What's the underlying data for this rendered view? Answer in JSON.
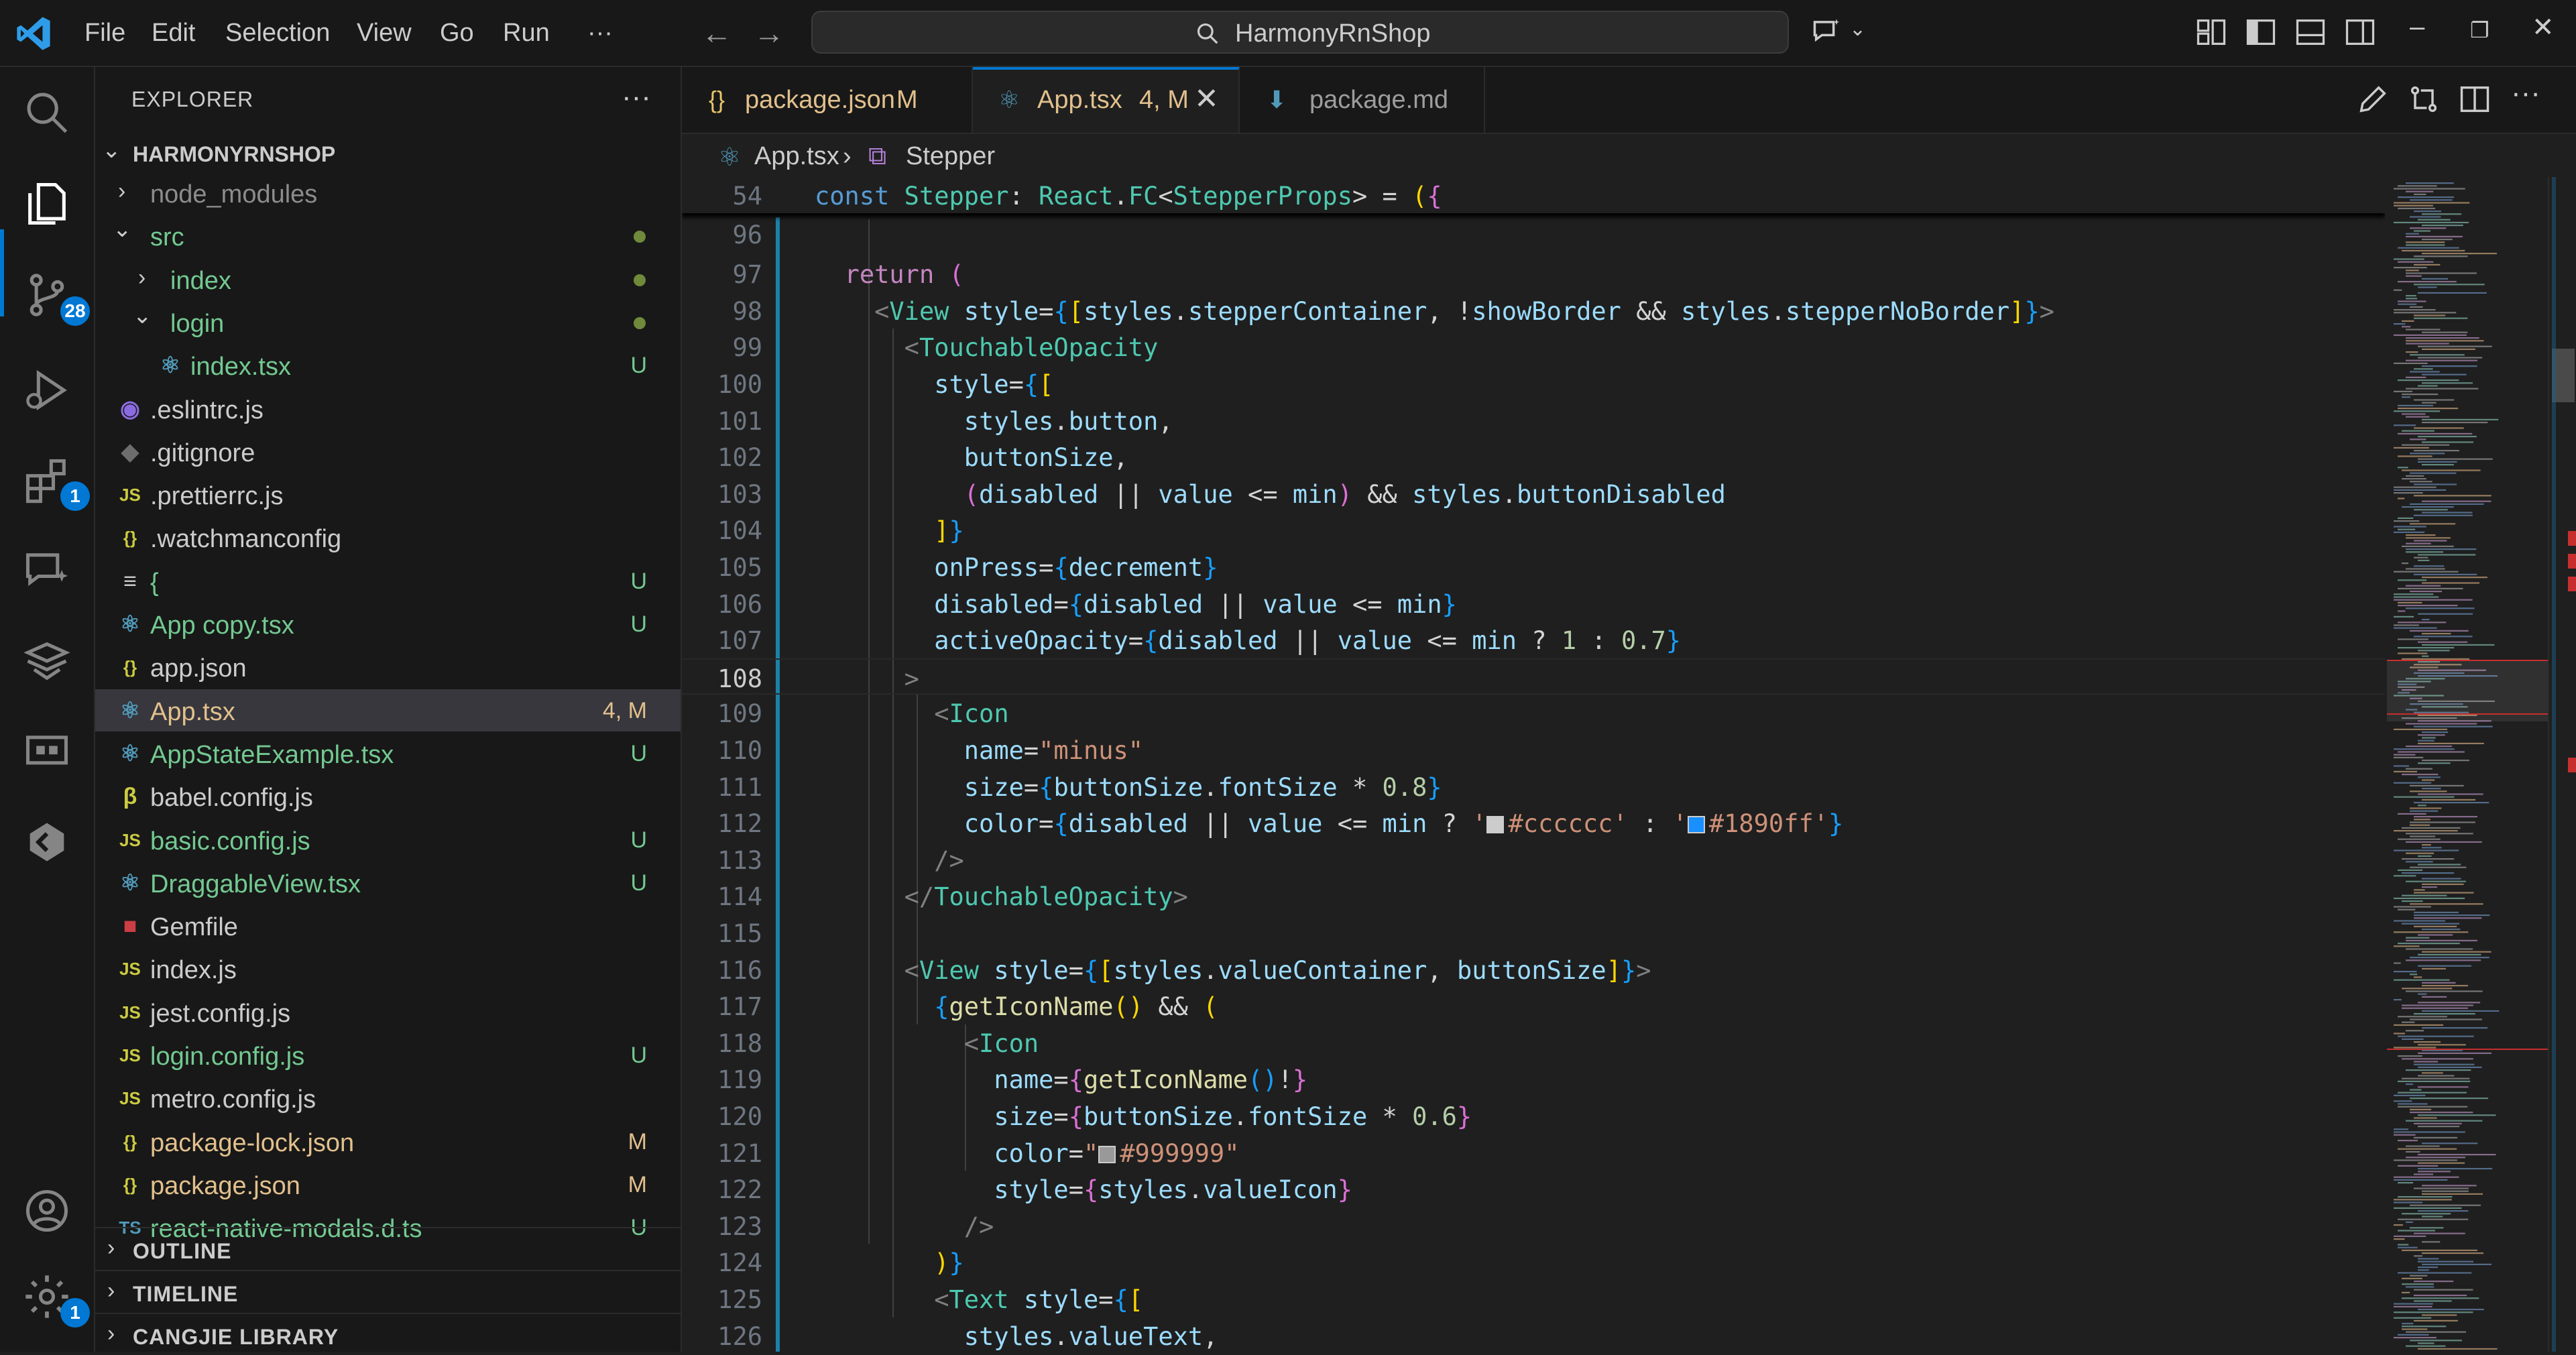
{
  "titlebar": {
    "menus": [
      "File",
      "Edit",
      "Selection",
      "View",
      "Go",
      "Run",
      "···"
    ],
    "search_text": "HarmonyRnShop"
  },
  "activity": {
    "source_control_badge": "28",
    "extensions_badge": "1",
    "settings_badge": "1"
  },
  "explorer": {
    "title": "EXPLORER",
    "more": "···",
    "root": "HARMONYRNSHOP",
    "items": [
      {
        "label": "node_modules",
        "type": "folder-collapsed",
        "indent": 1,
        "color": "#8c8c8c"
      },
      {
        "label": "src",
        "type": "folder-open",
        "indent": 1,
        "color": "#73c991",
        "dot": true
      },
      {
        "label": "index",
        "type": "folder-collapsed",
        "indent": 2,
        "color": "#73c991",
        "dot": true
      },
      {
        "label": "login",
        "type": "folder-open",
        "indent": 2,
        "color": "#73c991",
        "dot": true
      },
      {
        "label": "index.tsx",
        "type": "react",
        "indent": 3,
        "color": "#73c991",
        "status": "U"
      },
      {
        "label": ".eslintrc.js",
        "type": "eslint",
        "indent": 1,
        "color": "#cccccc"
      },
      {
        "label": ".gitignore",
        "type": "git",
        "indent": 1,
        "color": "#cccccc"
      },
      {
        "label": ".prettierrc.js",
        "type": "js",
        "indent": 1,
        "color": "#cccccc"
      },
      {
        "label": ".watchmanconfig",
        "type": "json",
        "indent": 1,
        "color": "#cccccc"
      },
      {
        "label": "{",
        "type": "text",
        "indent": 1,
        "color": "#73c991",
        "status": "U"
      },
      {
        "label": "App copy.tsx",
        "type": "react",
        "indent": 1,
        "color": "#73c991",
        "status": "U"
      },
      {
        "label": "app.json",
        "type": "json",
        "indent": 1,
        "color": "#cccccc"
      },
      {
        "label": "App.tsx",
        "type": "react",
        "indent": 1,
        "color": "#e2c08d",
        "status": "4, M",
        "selected": true
      },
      {
        "label": "AppStateExample.tsx",
        "type": "react",
        "indent": 1,
        "color": "#73c991",
        "status": "U"
      },
      {
        "label": "babel.config.js",
        "type": "babel",
        "indent": 1,
        "color": "#cccccc"
      },
      {
        "label": "basic.config.js",
        "type": "js",
        "indent": 1,
        "color": "#73c991",
        "status": "U"
      },
      {
        "label": "DraggableView.tsx",
        "type": "react",
        "indent": 1,
        "color": "#73c991",
        "status": "U"
      },
      {
        "label": "Gemfile",
        "type": "ruby",
        "indent": 1,
        "color": "#cccccc"
      },
      {
        "label": "index.js",
        "type": "js",
        "indent": 1,
        "color": "#cccccc"
      },
      {
        "label": "jest.config.js",
        "type": "js",
        "indent": 1,
        "color": "#cccccc"
      },
      {
        "label": "login.config.js",
        "type": "js",
        "indent": 1,
        "color": "#73c991",
        "status": "U"
      },
      {
        "label": "metro.config.js",
        "type": "js",
        "indent": 1,
        "color": "#cccccc"
      },
      {
        "label": "package-lock.json",
        "type": "json",
        "indent": 1,
        "color": "#e2c08d",
        "status": "M"
      },
      {
        "label": "package.json",
        "type": "json",
        "indent": 1,
        "color": "#e2c08d",
        "status": "M"
      },
      {
        "label": "react-native-modals.d.ts",
        "type": "ts",
        "indent": 1,
        "color": "#73c991",
        "status": "U"
      }
    ],
    "sections": [
      "OUTLINE",
      "TIMELINE",
      "CANGJIE LIBRARY"
    ]
  },
  "tabs": [
    {
      "icon": "{}",
      "label": "package.json",
      "suffix": "M",
      "color": "#e2c08d",
      "active": false
    },
    {
      "icon": "⚛",
      "label": "App.tsx",
      "suffix": "4, M",
      "color": "#e2c08d",
      "active": true
    },
    {
      "icon": "⬇",
      "label": "package.md",
      "suffix": "",
      "color": "#9d9d9d",
      "active": false
    }
  ],
  "breadcrumb": {
    "file": "App.tsx",
    "symbol": "Stepper"
  },
  "editor": {
    "current_line": "108",
    "lines": [
      {
        "n": "54",
        "sticky": true,
        "code": [
          [
            "k",
            "const "
          ],
          [
            "c",
            "Stepper"
          ],
          [
            "p",
            ": "
          ],
          [
            "c",
            "React"
          ],
          [
            "p",
            "."
          ],
          [
            "c",
            "FC"
          ],
          [
            "p",
            "<"
          ],
          [
            "c",
            "StepperProps"
          ],
          [
            "p",
            "> = "
          ],
          [
            "b1",
            "("
          ],
          [
            "b2",
            "{"
          ]
        ]
      },
      {
        "n": "96",
        "code": []
      },
      {
        "n": "97",
        "code": [
          [
            "p",
            "  "
          ],
          [
            "kw",
            "return"
          ],
          [
            "p",
            " "
          ],
          [
            "b2",
            "("
          ]
        ]
      },
      {
        "n": "98",
        "code": [
          [
            "p",
            "    "
          ],
          [
            "t",
            "<"
          ],
          [
            "c",
            "View"
          ],
          [
            "p",
            " "
          ],
          [
            "v",
            "style"
          ],
          [
            "p",
            "="
          ],
          [
            "b3",
            "{"
          ],
          [
            "b1",
            "["
          ],
          [
            "v",
            "styles"
          ],
          [
            "p",
            "."
          ],
          [
            "v",
            "stepperContainer"
          ],
          [
            "p",
            ", !"
          ],
          [
            "v",
            "showBorder"
          ],
          [
            "p",
            " && "
          ],
          [
            "v",
            "styles"
          ],
          [
            "p",
            "."
          ],
          [
            "v",
            "stepperNoBorder"
          ],
          [
            "b1",
            "]"
          ],
          [
            "b3",
            "}"
          ],
          [
            "t",
            ">"
          ]
        ]
      },
      {
        "n": "99",
        "code": [
          [
            "p",
            "      "
          ],
          [
            "t",
            "<"
          ],
          [
            "c",
            "TouchableOpacity"
          ]
        ]
      },
      {
        "n": "100",
        "code": [
          [
            "p",
            "        "
          ],
          [
            "v",
            "style"
          ],
          [
            "p",
            "="
          ],
          [
            "b3",
            "{"
          ],
          [
            "b1",
            "["
          ]
        ]
      },
      {
        "n": "101",
        "code": [
          [
            "p",
            "          "
          ],
          [
            "v",
            "styles"
          ],
          [
            "p",
            "."
          ],
          [
            "v",
            "button"
          ],
          [
            "p",
            ","
          ]
        ]
      },
      {
        "n": "102",
        "code": [
          [
            "p",
            "          "
          ],
          [
            "v",
            "buttonSize"
          ],
          [
            "p",
            ","
          ]
        ]
      },
      {
        "n": "103",
        "code": [
          [
            "p",
            "          "
          ],
          [
            "b2",
            "("
          ],
          [
            "v",
            "disabled"
          ],
          [
            "p",
            " || "
          ],
          [
            "v",
            "value"
          ],
          [
            "p",
            " <= "
          ],
          [
            "v",
            "min"
          ],
          [
            "b2",
            ")"
          ],
          [
            "p",
            " && "
          ],
          [
            "v",
            "styles"
          ],
          [
            "p",
            "."
          ],
          [
            "v",
            "buttonDisabled"
          ]
        ]
      },
      {
        "n": "104",
        "code": [
          [
            "p",
            "        "
          ],
          [
            "b1",
            "]"
          ],
          [
            "b3",
            "}"
          ]
        ]
      },
      {
        "n": "105",
        "code": [
          [
            "p",
            "        "
          ],
          [
            "v",
            "onPress"
          ],
          [
            "p",
            "="
          ],
          [
            "b3",
            "{"
          ],
          [
            "v",
            "decrement"
          ],
          [
            "b3",
            "}"
          ]
        ]
      },
      {
        "n": "106",
        "code": [
          [
            "p",
            "        "
          ],
          [
            "v",
            "disabled"
          ],
          [
            "p",
            "="
          ],
          [
            "b3",
            "{"
          ],
          [
            "v",
            "disabled"
          ],
          [
            "p",
            " || "
          ],
          [
            "v",
            "value"
          ],
          [
            "p",
            " <= "
          ],
          [
            "v",
            "min"
          ],
          [
            "b3",
            "}"
          ]
        ]
      },
      {
        "n": "107",
        "code": [
          [
            "p",
            "        "
          ],
          [
            "v",
            "activeOpacity"
          ],
          [
            "p",
            "="
          ],
          [
            "b3",
            "{"
          ],
          [
            "v",
            "disabled"
          ],
          [
            "p",
            " || "
          ],
          [
            "v",
            "value"
          ],
          [
            "p",
            " <= "
          ],
          [
            "v",
            "min"
          ],
          [
            "p",
            " ? "
          ],
          [
            "n",
            "1"
          ],
          [
            "p",
            " : "
          ],
          [
            "n",
            "0.7"
          ],
          [
            "b3",
            "}"
          ]
        ]
      },
      {
        "n": "108",
        "code": [
          [
            "p",
            "      "
          ],
          [
            "t",
            ">"
          ]
        ]
      },
      {
        "n": "109",
        "code": [
          [
            "p",
            "        "
          ],
          [
            "t",
            "<"
          ],
          [
            "c",
            "Icon"
          ]
        ]
      },
      {
        "n": "110",
        "code": [
          [
            "p",
            "          "
          ],
          [
            "v",
            "name"
          ],
          [
            "p",
            "="
          ],
          [
            "s",
            "\"minus\""
          ]
        ]
      },
      {
        "n": "111",
        "code": [
          [
            "p",
            "          "
          ],
          [
            "v",
            "size"
          ],
          [
            "p",
            "="
          ],
          [
            "b3",
            "{"
          ],
          [
            "v",
            "buttonSize"
          ],
          [
            "p",
            "."
          ],
          [
            "v",
            "fontSize"
          ],
          [
            "p",
            " * "
          ],
          [
            "n",
            "0.8"
          ],
          [
            "b3",
            "}"
          ]
        ]
      },
      {
        "n": "112",
        "code": [
          [
            "p",
            "          "
          ],
          [
            "v",
            "color"
          ],
          [
            "p",
            "="
          ],
          [
            "b3",
            "{"
          ],
          [
            "v",
            "disabled"
          ],
          [
            "p",
            " || "
          ],
          [
            "v",
            "value"
          ],
          [
            "p",
            " <= "
          ],
          [
            "v",
            "min"
          ],
          [
            "p",
            " ? "
          ],
          [
            "s",
            "'"
          ],
          [
            "sw",
            "#cccccc"
          ],
          [
            "s",
            "#cccccc'"
          ],
          [
            "p",
            " : "
          ],
          [
            "s",
            "'"
          ],
          [
            "sw",
            "#1890ff"
          ],
          [
            "s",
            "#1890ff'"
          ],
          [
            "b3",
            "}"
          ]
        ]
      },
      {
        "n": "113",
        "code": [
          [
            "p",
            "        "
          ],
          [
            "t",
            "/>"
          ]
        ]
      },
      {
        "n": "114",
        "code": [
          [
            "p",
            "      "
          ],
          [
            "t",
            "</"
          ],
          [
            "c",
            "TouchableOpacity"
          ],
          [
            "t",
            ">"
          ]
        ]
      },
      {
        "n": "115",
        "code": []
      },
      {
        "n": "116",
        "code": [
          [
            "p",
            "      "
          ],
          [
            "t",
            "<"
          ],
          [
            "c",
            "View"
          ],
          [
            "p",
            " "
          ],
          [
            "v",
            "style"
          ],
          [
            "p",
            "="
          ],
          [
            "b3",
            "{"
          ],
          [
            "b1",
            "["
          ],
          [
            "v",
            "styles"
          ],
          [
            "p",
            "."
          ],
          [
            "v",
            "valueContainer"
          ],
          [
            "p",
            ", "
          ],
          [
            "v",
            "buttonSize"
          ],
          [
            "b1",
            "]"
          ],
          [
            "b3",
            "}"
          ],
          [
            "t",
            ">"
          ]
        ]
      },
      {
        "n": "117",
        "code": [
          [
            "p",
            "        "
          ],
          [
            "b3",
            "{"
          ],
          [
            "f",
            "getIconName"
          ],
          [
            "b1",
            "()"
          ],
          [
            "p",
            " && "
          ],
          [
            "b1",
            "("
          ]
        ]
      },
      {
        "n": "118",
        "code": [
          [
            "p",
            "          "
          ],
          [
            "t",
            "<"
          ],
          [
            "c",
            "Icon"
          ]
        ]
      },
      {
        "n": "119",
        "code": [
          [
            "p",
            "            "
          ],
          [
            "v",
            "name"
          ],
          [
            "p",
            "="
          ],
          [
            "b2",
            "{"
          ],
          [
            "f",
            "getIconName"
          ],
          [
            "b3",
            "()"
          ],
          [
            "p",
            "!"
          ],
          [
            "b2",
            "}"
          ]
        ]
      },
      {
        "n": "120",
        "code": [
          [
            "p",
            "            "
          ],
          [
            "v",
            "size"
          ],
          [
            "p",
            "="
          ],
          [
            "b2",
            "{"
          ],
          [
            "v",
            "buttonSize"
          ],
          [
            "p",
            "."
          ],
          [
            "v",
            "fontSize"
          ],
          [
            "p",
            " * "
          ],
          [
            "n",
            "0.6"
          ],
          [
            "b2",
            "}"
          ]
        ]
      },
      {
        "n": "121",
        "code": [
          [
            "p",
            "            "
          ],
          [
            "v",
            "color"
          ],
          [
            "p",
            "="
          ],
          [
            "s",
            "\""
          ],
          [
            "sw",
            "#999999"
          ],
          [
            "s",
            "#999999\""
          ]
        ]
      },
      {
        "n": "122",
        "code": [
          [
            "p",
            "            "
          ],
          [
            "v",
            "style"
          ],
          [
            "p",
            "="
          ],
          [
            "b2",
            "{"
          ],
          [
            "v",
            "styles"
          ],
          [
            "p",
            "."
          ],
          [
            "v",
            "valueIcon"
          ],
          [
            "b2",
            "}"
          ]
        ]
      },
      {
        "n": "123",
        "code": [
          [
            "p",
            "          "
          ],
          [
            "t",
            "/>"
          ]
        ]
      },
      {
        "n": "124",
        "code": [
          [
            "p",
            "        "
          ],
          [
            "b1",
            ")"
          ],
          [
            "b3",
            "}"
          ]
        ]
      },
      {
        "n": "125",
        "code": [
          [
            "p",
            "        "
          ],
          [
            "t",
            "<"
          ],
          [
            "c",
            "Text"
          ],
          [
            "p",
            " "
          ],
          [
            "v",
            "style"
          ],
          [
            "p",
            "="
          ],
          [
            "b3",
            "{"
          ],
          [
            "b1",
            "["
          ]
        ]
      },
      {
        "n": "126",
        "code": [
          [
            "p",
            "          "
          ],
          [
            "v",
            "styles"
          ],
          [
            "p",
            "."
          ],
          [
            "v",
            "valueText"
          ],
          [
            "p",
            ","
          ]
        ]
      }
    ]
  }
}
